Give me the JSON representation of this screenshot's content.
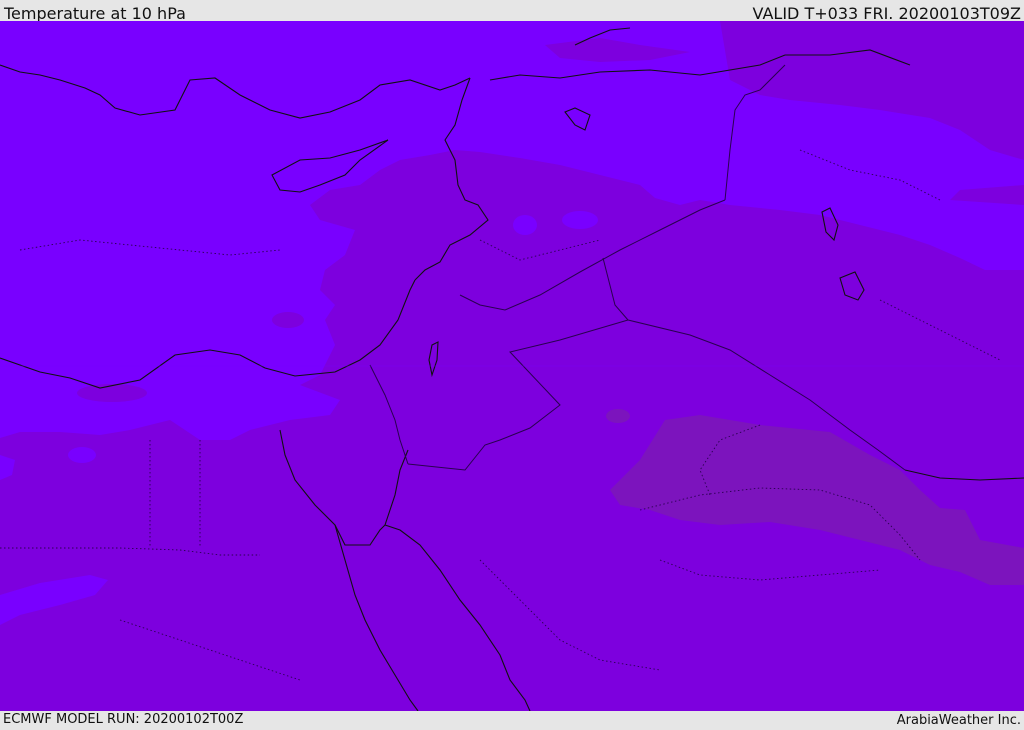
{
  "header": {
    "title": "Temperature at 10 hPa",
    "valid_time": "VALID T+033 FRI. 20200103T09Z"
  },
  "footer": {
    "model_run": "ECMWF MODEL RUN: 20200102T00Z",
    "credit": "ArabiaWeather Inc."
  },
  "map": {
    "colors": {
      "cold_band": "#7900ff",
      "mid_band": "#7d00de",
      "warm_band": "#7c14bd",
      "coastline": "#111111",
      "border": "#2a0050"
    }
  }
}
